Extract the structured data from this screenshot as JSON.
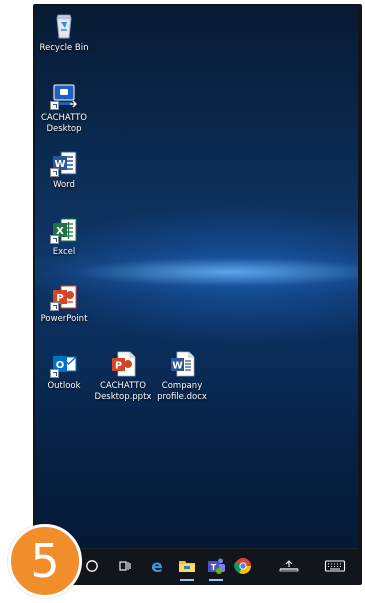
{
  "desktop": {
    "icons": [
      {
        "label": "Recycle Bin",
        "icon": "recycle-bin-icon"
      },
      {
        "label": "CACHATTO\nDesktop",
        "icon": "cachatto-desktop-icon"
      },
      {
        "label": "Word",
        "icon": "word-icon"
      },
      {
        "label": "Excel",
        "icon": "excel-icon"
      },
      {
        "label": "PowerPoint",
        "icon": "powerpoint-icon"
      },
      {
        "label": "Outlook",
        "icon": "outlook-icon"
      },
      {
        "label": "CACHATTO\nDesktop.pptx",
        "icon": "pptx-file-icon"
      },
      {
        "label": "Company\nprofile.docx",
        "icon": "docx-file-icon"
      }
    ]
  },
  "taskbar": {
    "items": [
      {
        "icon": "search-circle-icon"
      },
      {
        "icon": "task-view-icon"
      },
      {
        "icon": "edge-icon"
      },
      {
        "icon": "file-explorer-icon"
      },
      {
        "icon": "teams-icon"
      },
      {
        "icon": "chrome-icon"
      },
      {
        "icon": "notifications-up-icon"
      },
      {
        "icon": "keyboard-icon"
      }
    ]
  },
  "step_badge": {
    "number": "5",
    "color": "#f28d2b"
  },
  "colors": {
    "word": "#2b579a",
    "excel": "#217346",
    "powerpoint": "#d24726",
    "outlook": "#0072c6",
    "cachatto": "#1f5fbf"
  }
}
